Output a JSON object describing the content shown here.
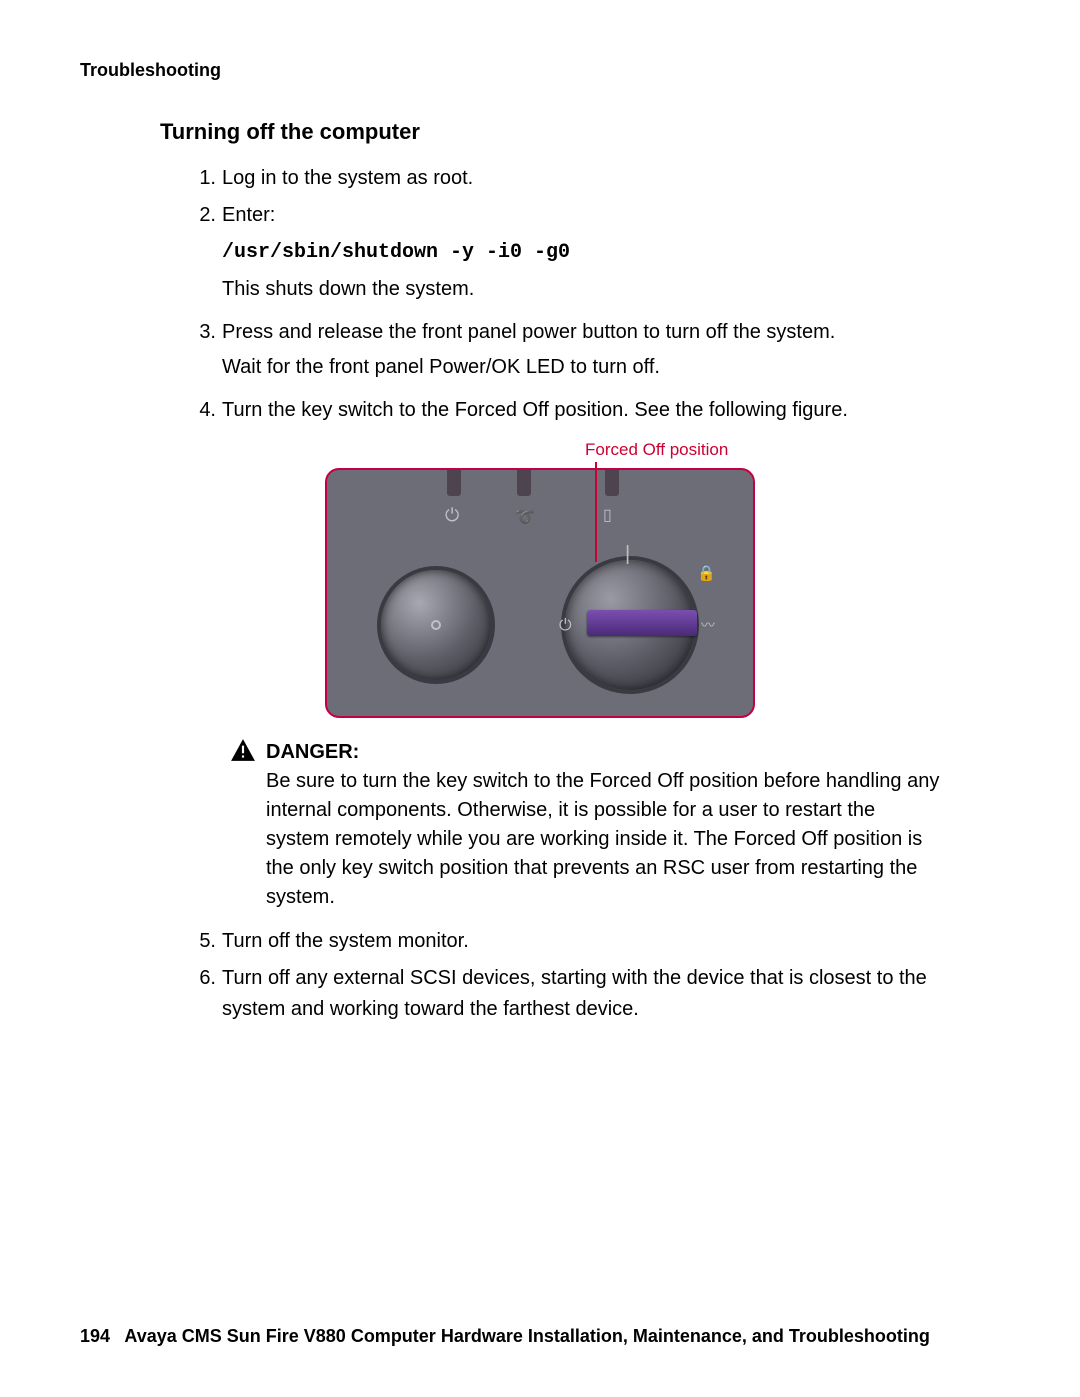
{
  "header": "Troubleshooting",
  "section_title": "Turning off the computer",
  "steps": {
    "s1": {
      "num": "1.",
      "text": "Log in to the system as root."
    },
    "s2": {
      "num": "2.",
      "text_intro": "Enter:",
      "command": "/usr/sbin/shutdown -y -i0 -g0",
      "text_after": "This shuts down the system."
    },
    "s3": {
      "num": "3.",
      "line1": "Press and release the front panel power button to turn off the system.",
      "line2": "Wait for the front panel Power/OK LED to turn off."
    },
    "s4": {
      "num": "4.",
      "text": "Turn the key switch to the Forced Off position. See the following figure."
    },
    "s5": {
      "num": "5.",
      "text": "Turn off the system monitor."
    },
    "s6": {
      "num": "6.",
      "text": "Turn off any external SCSI devices, starting with the device that is closest to the system and working toward the farthest device."
    }
  },
  "figure": {
    "callout": "Forced Off position",
    "icons": {
      "power_glyph": "⏻",
      "bar_glyph": "|",
      "lock_glyph": "🔒",
      "diag_glyph": "〰",
      "top_power": "⏻",
      "top_wrench": "➰",
      "top_doc": "▯"
    }
  },
  "danger": {
    "label": "DANGER:",
    "text": "Be sure to turn the key switch to the Forced Off position before handling any internal components. Otherwise, it is possible for a user to restart the system remotely while you are working inside it. The Forced Off position is the only key switch position that prevents an RSC user from restarting the system."
  },
  "footer": {
    "page": "194",
    "title": "Avaya CMS Sun Fire V880 Computer Hardware Installation, Maintenance, and Troubleshooting"
  }
}
